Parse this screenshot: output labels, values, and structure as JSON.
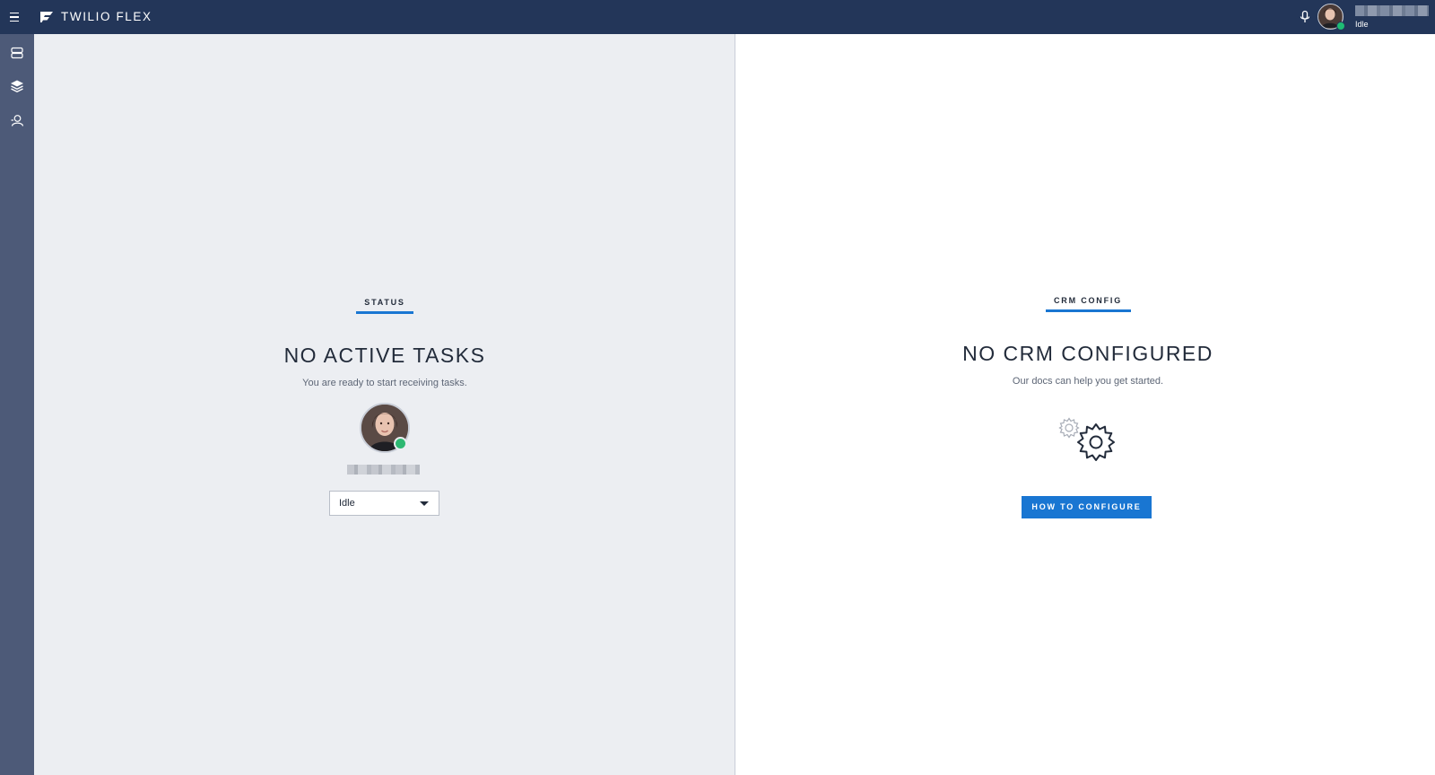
{
  "topbar": {
    "brand": "TWILIO FLEX",
    "user_status": "Idle"
  },
  "sidenav": {
    "items": [
      "tasks-icon",
      "layers-icon",
      "user-directory-icon"
    ]
  },
  "status_panel": {
    "section_label": "STATUS",
    "headline": "NO ACTIVE TASKS",
    "subtext": "You are ready to start receiving tasks.",
    "activity_value": "Idle"
  },
  "crm_panel": {
    "section_label": "CRM CONFIG",
    "headline": "NO CRM CONFIGURED",
    "subtext": "Our docs can help you get started.",
    "button_label": "HOW TO CONFIGURE"
  },
  "colors": {
    "topbar": "#233659",
    "sidenav": "#4d5a78",
    "accent": "#1976d2",
    "available": "#2eb872"
  }
}
